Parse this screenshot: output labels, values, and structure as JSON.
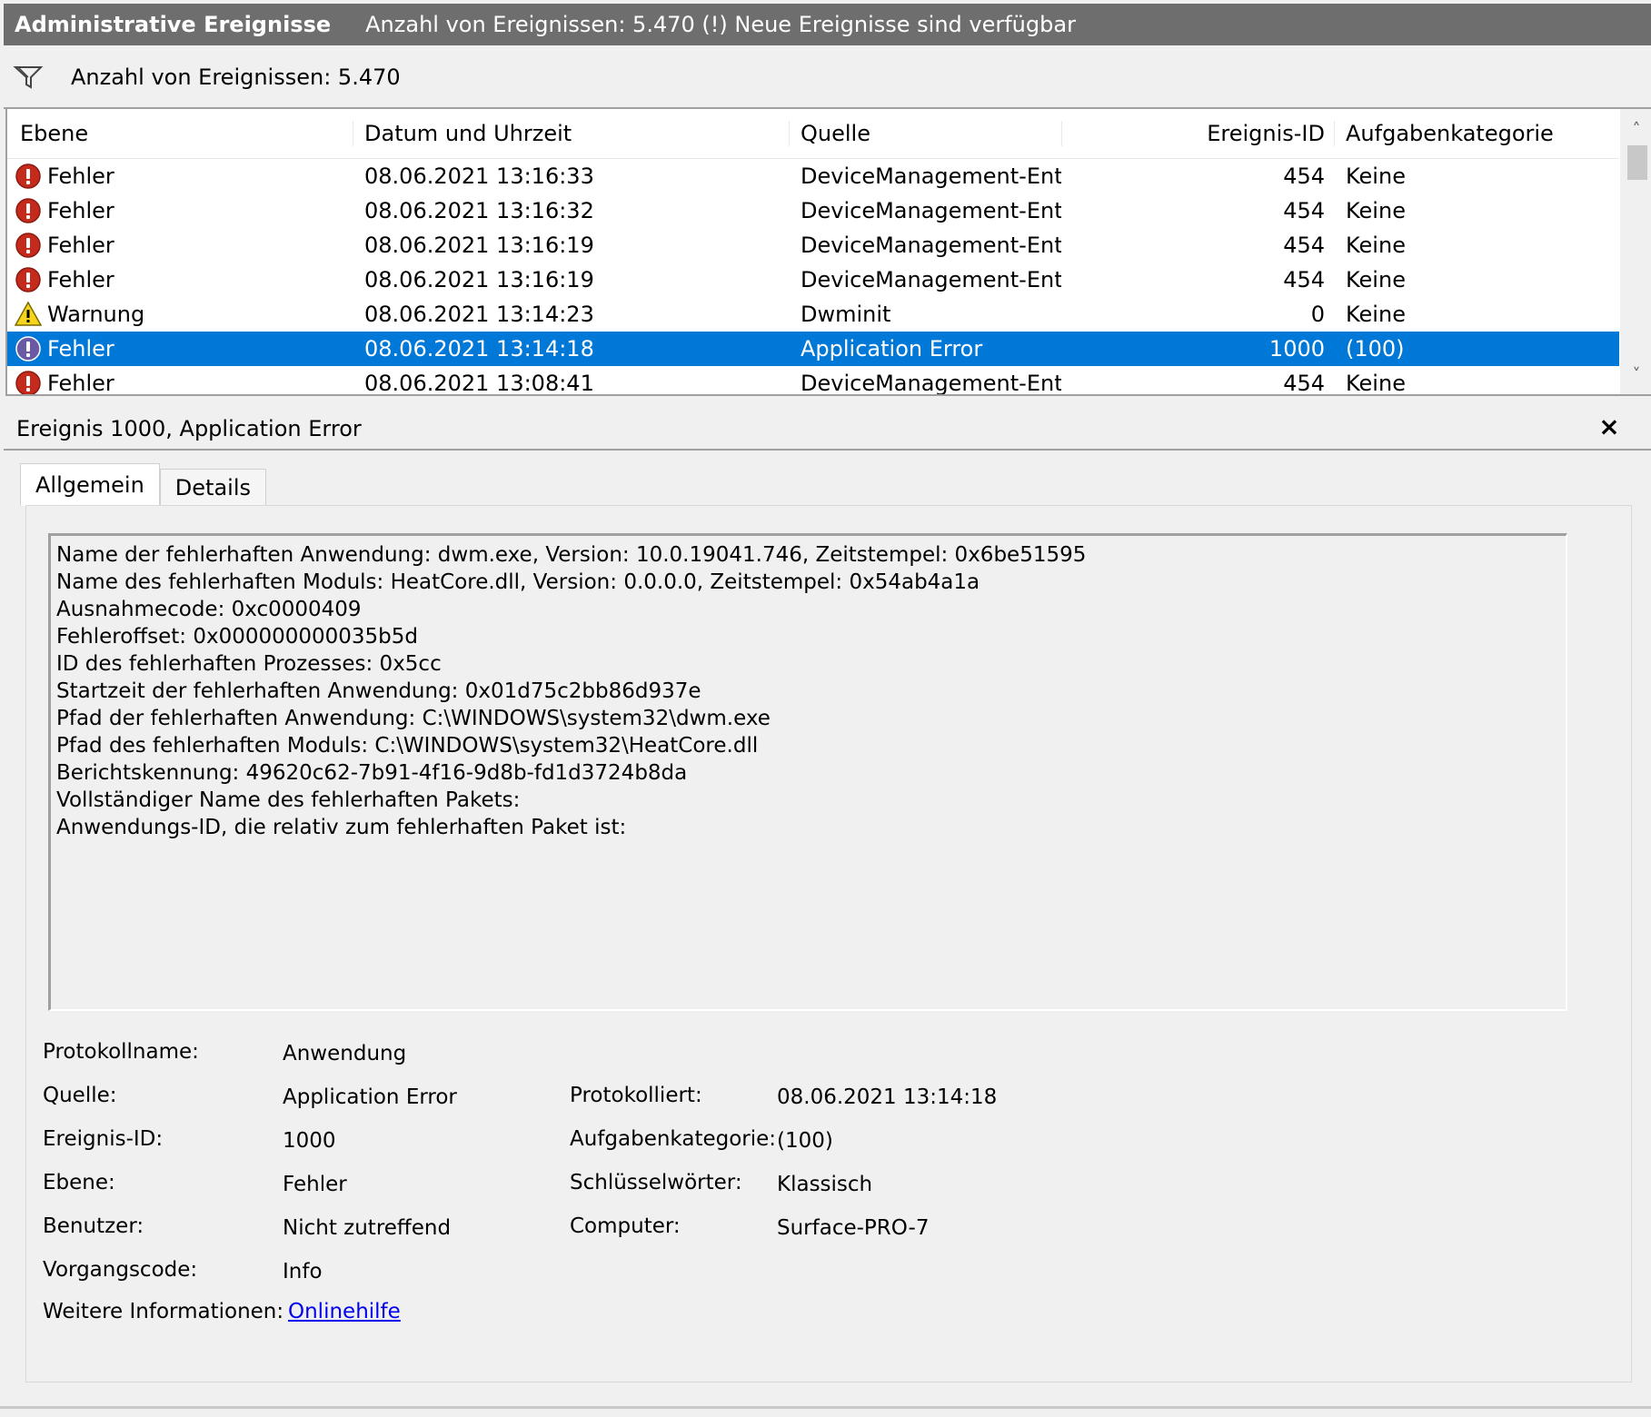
{
  "titlebar": {
    "title": "Administrative Ereignisse",
    "status": "Anzahl von Ereignissen: 5.470 (!) Neue Ereignisse sind verfügbar"
  },
  "filterbar": {
    "icon": "filter-icon",
    "count": "Anzahl von Ereignissen: 5.470"
  },
  "eventlist": {
    "columns": {
      "level": "Ebene",
      "date": "Datum und Uhrzeit",
      "source": "Quelle",
      "id": "Ereignis-ID",
      "task": "Aufgabenkategorie"
    },
    "rows": [
      {
        "level": "Fehler",
        "icon": "error-icon",
        "date": "08.06.2021 13:16:33",
        "source": "DeviceManagement-Ent...",
        "id": "454",
        "task": "Keine",
        "selected": false
      },
      {
        "level": "Fehler",
        "icon": "error-icon",
        "date": "08.06.2021 13:16:32",
        "source": "DeviceManagement-Ent...",
        "id": "454",
        "task": "Keine",
        "selected": false
      },
      {
        "level": "Fehler",
        "icon": "error-icon",
        "date": "08.06.2021 13:16:19",
        "source": "DeviceManagement-Ent...",
        "id": "454",
        "task": "Keine",
        "selected": false
      },
      {
        "level": "Fehler",
        "icon": "error-icon",
        "date": "08.06.2021 13:16:19",
        "source": "DeviceManagement-Ent...",
        "id": "454",
        "task": "Keine",
        "selected": false
      },
      {
        "level": "Warnung",
        "icon": "warning-icon",
        "date": "08.06.2021 13:14:23",
        "source": "Dwminit",
        "id": "0",
        "task": "Keine",
        "selected": false
      },
      {
        "level": "Fehler",
        "icon": "error-icon",
        "date": "08.06.2021 13:14:18",
        "source": "Application Error",
        "id": "1000",
        "task": "(100)",
        "selected": true
      },
      {
        "level": "Fehler",
        "icon": "error-icon",
        "date": "08.06.2021 13:08:41",
        "source": "DeviceManagement-Ent...",
        "id": "454",
        "task": "Keine",
        "selected": false
      }
    ]
  },
  "detail": {
    "title": "Ereignis 1000, Application Error",
    "close": "×",
    "tabs": {
      "general": "Allgemein",
      "details": "Details"
    },
    "message": [
      "Name der fehlerhaften Anwendung: dwm.exe, Version: 10.0.19041.746, Zeitstempel: 0x6be51595",
      "Name des fehlerhaften Moduls: HeatCore.dll, Version: 0.0.0.0, Zeitstempel: 0x54ab4a1a",
      "Ausnahmecode: 0xc0000409",
      "Fehleroffset: 0x000000000035b5d",
      "ID des fehlerhaften Prozesses: 0x5cc",
      "Startzeit der fehlerhaften Anwendung: 0x01d75c2bb86d937e",
      "Pfad der fehlerhaften Anwendung: C:\\WINDOWS\\system32\\dwm.exe",
      "Pfad des fehlerhaften Moduls: C:\\WINDOWS\\system32\\HeatCore.dll",
      "Berichtskennung: 49620c62-7b91-4f16-9d8b-fd1d3724b8da",
      "Vollständiger Name des fehlerhaften Pakets:",
      "Anwendungs-ID, die relativ zum fehlerhaften Paket ist:"
    ],
    "props": {
      "logname_label": "Protokollname:",
      "logname_value": "Anwendung",
      "source_label": "Quelle:",
      "source_value": "Application Error",
      "logged_label": "Protokolliert:",
      "logged_value": "08.06.2021 13:14:18",
      "eventid_label": "Ereignis-ID:",
      "eventid_value": "1000",
      "task_label": "Aufgabenkategorie:",
      "task_value": "(100)",
      "level_label": "Ebene:",
      "level_value": "Fehler",
      "keywords_label": "Schlüsselwörter:",
      "keywords_value": "Klassisch",
      "user_label": "Benutzer:",
      "user_value": "Nicht zutreffend",
      "computer_label": "Computer:",
      "computer_value": "Surface-PRO-7",
      "opcode_label": "Vorgangscode:",
      "opcode_value": "Info",
      "moreinfo_label": "Weitere Informationen:",
      "moreinfo_link": "Onlinehilfe"
    }
  }
}
